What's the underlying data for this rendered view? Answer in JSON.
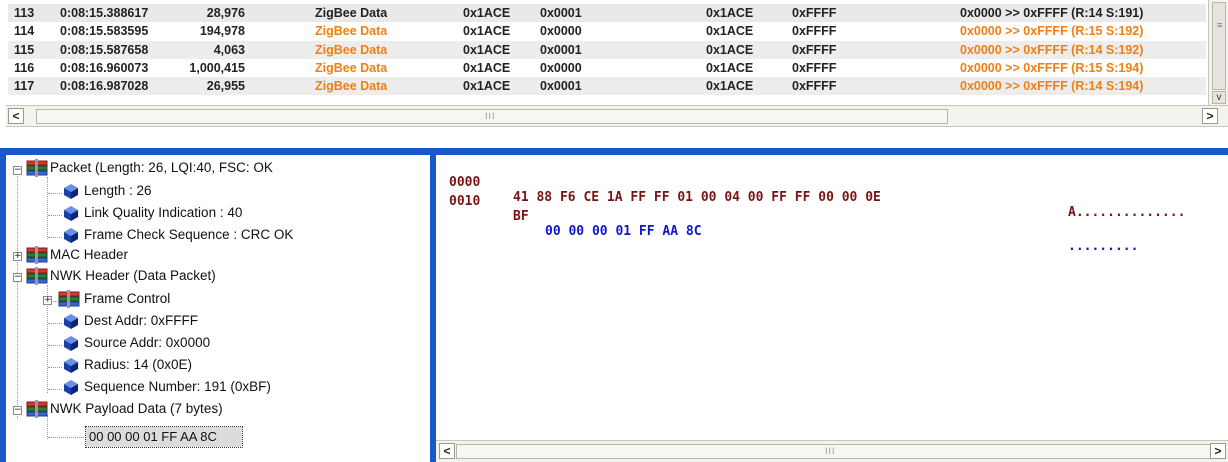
{
  "colors": {
    "orange": "#f07f14",
    "dark": "#222222",
    "hex_maroon": "#7a1414",
    "hex_blue": "#1414cc",
    "accent_blue": "#1a58c7"
  },
  "packets": [
    {
      "no": "113",
      "time": "0:08:15.388617",
      "delta": "28,976",
      "type": "ZigBee Data",
      "panid": "0x1ACE",
      "src": "0x0001",
      "panid2": "0x1ACE",
      "dst": "0xFFFF",
      "route": "0x0000 >> 0xFFFF (R:14 S:191)"
    },
    {
      "no": "114",
      "time": "0:08:15.583595",
      "delta": "194,978",
      "type": "ZigBee Data",
      "panid": "0x1ACE",
      "src": "0x0000",
      "panid2": "0x1ACE",
      "dst": "0xFFFF",
      "route": "0x0000 >> 0xFFFF (R:15 S:192)"
    },
    {
      "no": "115",
      "time": "0:08:15.587658",
      "delta": "4,063",
      "type": "ZigBee Data",
      "panid": "0x1ACE",
      "src": "0x0001",
      "panid2": "0x1ACE",
      "dst": "0xFFFF",
      "route": "0x0000 >> 0xFFFF (R:14 S:192)"
    },
    {
      "no": "116",
      "time": "0:08:16.960073",
      "delta": "1,000,415",
      "type": "ZigBee Data",
      "panid": "0x1ACE",
      "src": "0x0000",
      "panid2": "0x1ACE",
      "dst": "0xFFFF",
      "route": "0x0000 >> 0xFFFF (R:15 S:194)"
    },
    {
      "no": "117",
      "time": "0:08:16.987028",
      "delta": "26,955",
      "type": "ZigBee Data",
      "panid": "0x1ACE",
      "src": "0x0001",
      "panid2": "0x1ACE",
      "dst": "0xFFFF",
      "route": "0x0000 >> 0xFFFF (R:14 S:194)"
    }
  ],
  "tree": {
    "packet": "Packet (Length: 26,  LQI:40,  FSC: OK",
    "length": "Length : 26",
    "lqi": "Link Quality Indication : 40",
    "fcs": "Frame Check Sequence : CRC OK",
    "mac": "MAC Header",
    "nwk": "NWK Header (Data Packet)",
    "frame_control": "Frame Control",
    "dest": "Dest Addr: 0xFFFF",
    "source": "Source Addr: 0x0000",
    "radius": "Radius: 14 (0x0E)",
    "seq": "Sequence Number: 191 (0xBF)",
    "payload": "NWK Payload Data (7 bytes)",
    "payload_bytes": "00 00 00 01 FF AA 8C"
  },
  "hex": {
    "row1_offset": "0000",
    "row1_bytes_a": "41 88 F6 CE 1A FF FF 01 00 04 00 FF FF 00 00 0E",
    "row1_ascii": "A..............",
    "row2_offset": "0010",
    "row2_bytes_a": "BF",
    "row2_bytes_b": "00 00 00 01 FF AA 8C",
    "row2_ascii": "........."
  },
  "scroll": {
    "left_arrow": "<",
    "right_arrow": ">",
    "down_arrow": "v",
    "grip": "III",
    "vgrip": "≡"
  }
}
